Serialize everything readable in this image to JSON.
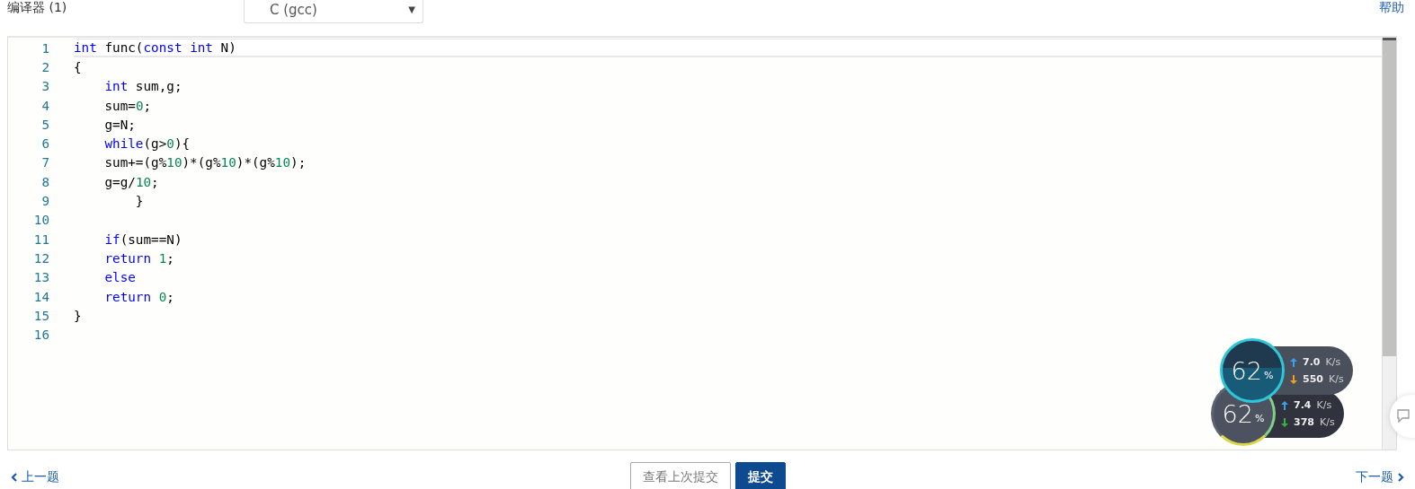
{
  "header": {
    "title": "编译器 (1)",
    "language_select": {
      "value": "C (gcc)",
      "arrow": "▼"
    },
    "help_link": "帮助"
  },
  "editor": {
    "lines": [
      {
        "number": "1",
        "active": true,
        "tokens": [
          {
            "kind": "kw",
            "text": "int"
          },
          {
            "kind": "plain",
            "text": " func("
          },
          {
            "kind": "kw",
            "text": "const"
          },
          {
            "kind": "kw",
            "text": " int"
          },
          {
            "kind": "plain",
            "text": " N)"
          }
        ]
      },
      {
        "number": "2",
        "active": false,
        "tokens": [
          {
            "kind": "plain",
            "text": "{"
          }
        ]
      },
      {
        "number": "3",
        "active": false,
        "tokens": [
          {
            "kind": "kw",
            "text": "    int"
          },
          {
            "kind": "plain",
            "text": " sum,g;"
          }
        ]
      },
      {
        "number": "4",
        "active": false,
        "tokens": [
          {
            "kind": "plain",
            "text": "    sum="
          },
          {
            "kind": "num",
            "text": "0"
          },
          {
            "kind": "plain",
            "text": ";"
          }
        ]
      },
      {
        "number": "5",
        "active": false,
        "tokens": [
          {
            "kind": "plain",
            "text": "    g=N;"
          }
        ]
      },
      {
        "number": "6",
        "active": false,
        "tokens": [
          {
            "kind": "kw",
            "text": "    while"
          },
          {
            "kind": "plain",
            "text": "(g>"
          },
          {
            "kind": "num",
            "text": "0"
          },
          {
            "kind": "plain",
            "text": "){"
          }
        ]
      },
      {
        "number": "7",
        "active": false,
        "tokens": [
          {
            "kind": "plain",
            "text": "    sum+=(g%"
          },
          {
            "kind": "num",
            "text": "10"
          },
          {
            "kind": "plain",
            "text": ")*(g%"
          },
          {
            "kind": "num",
            "text": "10"
          },
          {
            "kind": "plain",
            "text": ")*(g%"
          },
          {
            "kind": "num",
            "text": "10"
          },
          {
            "kind": "plain",
            "text": ");"
          }
        ]
      },
      {
        "number": "8",
        "active": false,
        "tokens": [
          {
            "kind": "plain",
            "text": "    g=g/"
          },
          {
            "kind": "num",
            "text": "10"
          },
          {
            "kind": "plain",
            "text": ";"
          }
        ]
      },
      {
        "number": "9",
        "active": false,
        "tokens": [
          {
            "kind": "plain",
            "text": "        }"
          }
        ]
      },
      {
        "number": "10",
        "active": false
      },
      {
        "number": "11",
        "active": false,
        "tokens": [
          {
            "kind": "kw",
            "text": "    if"
          },
          {
            "kind": "plain",
            "text": "(sum==N)"
          }
        ]
      },
      {
        "number": "12",
        "active": false,
        "tokens": [
          {
            "kind": "kw",
            "text": "    return"
          },
          {
            "kind": "num",
            "text": " 1"
          },
          {
            "kind": "plain",
            "text": ";"
          }
        ]
      },
      {
        "number": "13",
        "active": false,
        "tokens": [
          {
            "kind": "kw",
            "text": "    else"
          }
        ]
      },
      {
        "number": "14",
        "active": false,
        "tokens": [
          {
            "kind": "kw",
            "text": "    return"
          },
          {
            "kind": "num",
            "text": " 0"
          },
          {
            "kind": "plain",
            "text": ";"
          }
        ]
      },
      {
        "number": "15",
        "active": false,
        "tokens": [
          {
            "kind": "plain",
            "text": "}"
          }
        ]
      },
      {
        "number": "16",
        "active": false
      }
    ]
  },
  "speed_widgets": [
    {
      "percent": "62",
      "percent_unit": "%",
      "upload": "7.0",
      "upload_unit": "K/s",
      "download": "550",
      "download_unit": "K/s"
    },
    {
      "percent": "62",
      "percent_unit": "%",
      "upload": "7.4",
      "upload_unit": "K/s",
      "download": "378",
      "download_unit": "K/s"
    }
  ],
  "footer": {
    "prev_link": "上一题",
    "view_last_button": "查看上次提交",
    "submit_button": "提交",
    "next_link": "下一题"
  }
}
